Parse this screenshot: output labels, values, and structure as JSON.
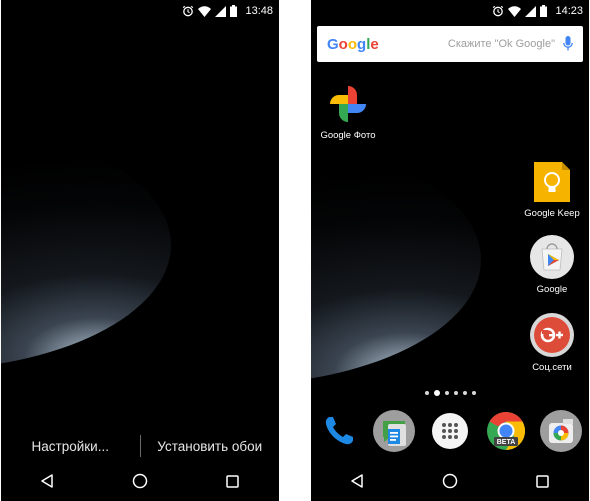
{
  "left_screen": {
    "status": {
      "time": "13:48"
    },
    "wallpaper_actions": {
      "settings_label": "Настройки...",
      "set_wallpaper_label": "Установить обои"
    }
  },
  "right_screen": {
    "status": {
      "time": "14:23"
    },
    "search": {
      "logo_letters": [
        "G",
        "o",
        "o",
        "g",
        "l",
        "e"
      ],
      "logo_colors": [
        "#4285F4",
        "#EA4335",
        "#FBBC05",
        "#4285F4",
        "#34A853",
        "#EA4335"
      ],
      "placeholder": "Скажите \"Ok Google\""
    },
    "apps": {
      "photos": "Google Фото",
      "keep": "Google Keep",
      "play": "Google",
      "social": "Соц.сети"
    },
    "page_dots": {
      "count": 6,
      "active_index": 1
    },
    "dock": [
      "phone-icon",
      "messenger-icon",
      "app-drawer-icon",
      "chrome-beta-icon",
      "camera-icon"
    ],
    "chrome_badge": "BETA"
  },
  "status_icons": [
    "alarm-icon",
    "wifi-icon",
    "signal-icon",
    "battery-icon"
  ],
  "nav_icons": [
    "back-icon",
    "home-icon",
    "recents-icon"
  ],
  "colors": {
    "google_blue": "#4285F4",
    "google_red": "#EA4335",
    "google_yellow": "#FBBC05",
    "google_green": "#34A853",
    "phone_blue": "#1e88e5",
    "keep_yellow": "#F6B400"
  }
}
